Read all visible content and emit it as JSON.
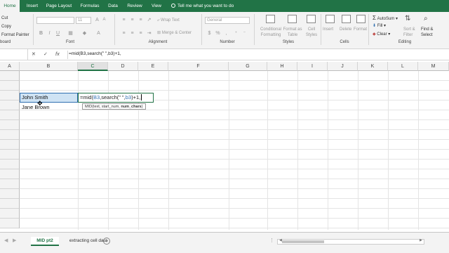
{
  "ribbon_tabs": [
    "Home",
    "Insert",
    "Page Layout",
    "Formulas",
    "Data",
    "Review",
    "View"
  ],
  "tell_me": "Tell me what you want to do",
  "clipboard": {
    "cut": "Cut",
    "copy": "Copy",
    "format_painter": "Format Painter",
    "label": "board"
  },
  "font": {
    "name": "",
    "size": "11",
    "label": "Font"
  },
  "alignment": {
    "wrap_text": "Wrap Text",
    "merge_center": "Merge & Center",
    "label": "Alignment"
  },
  "number": {
    "format": "General",
    "label": "Number"
  },
  "styles": {
    "conditional": [
      "Conditional",
      "Formatting"
    ],
    "format_as": [
      "Format as",
      "Table"
    ],
    "cell_styles": [
      "Cell",
      "Styles"
    ],
    "label": "Styles"
  },
  "cells": {
    "insert": "Insert",
    "delete": "Delete",
    "format": "Format",
    "label": "Cells"
  },
  "editing": {
    "autosum": "AutoSum",
    "fill": "Fill",
    "clear": "Clear",
    "sort": [
      "Sort &",
      "Filter"
    ],
    "find": [
      "Find &",
      "Select"
    ],
    "label": "Editing"
  },
  "formula_bar": {
    "cancel": "✕",
    "enter": "✓",
    "fx": "fx",
    "formula": "=mid(B3,search(\" \",b3)+1,"
  },
  "columns": [
    "A",
    "B",
    "C",
    "D",
    "E",
    "F",
    "G",
    "H",
    "I",
    "J",
    "K",
    "L",
    "M"
  ],
  "cells_data": {
    "b3": "John Smith",
    "b4": "Jane Brown"
  },
  "editing_cell": {
    "prefix": "=mid(",
    "ref": "B3",
    "mid": ",search(\" \",",
    "ref2": "b3",
    "suffix": ")+1,"
  },
  "tooltip": {
    "text": "MID(text, start_num, ",
    "bold": "num_chars",
    "close": ")"
  },
  "sheets": [
    "MID pt2",
    "extracting cell data"
  ],
  "add_sheet": "+"
}
